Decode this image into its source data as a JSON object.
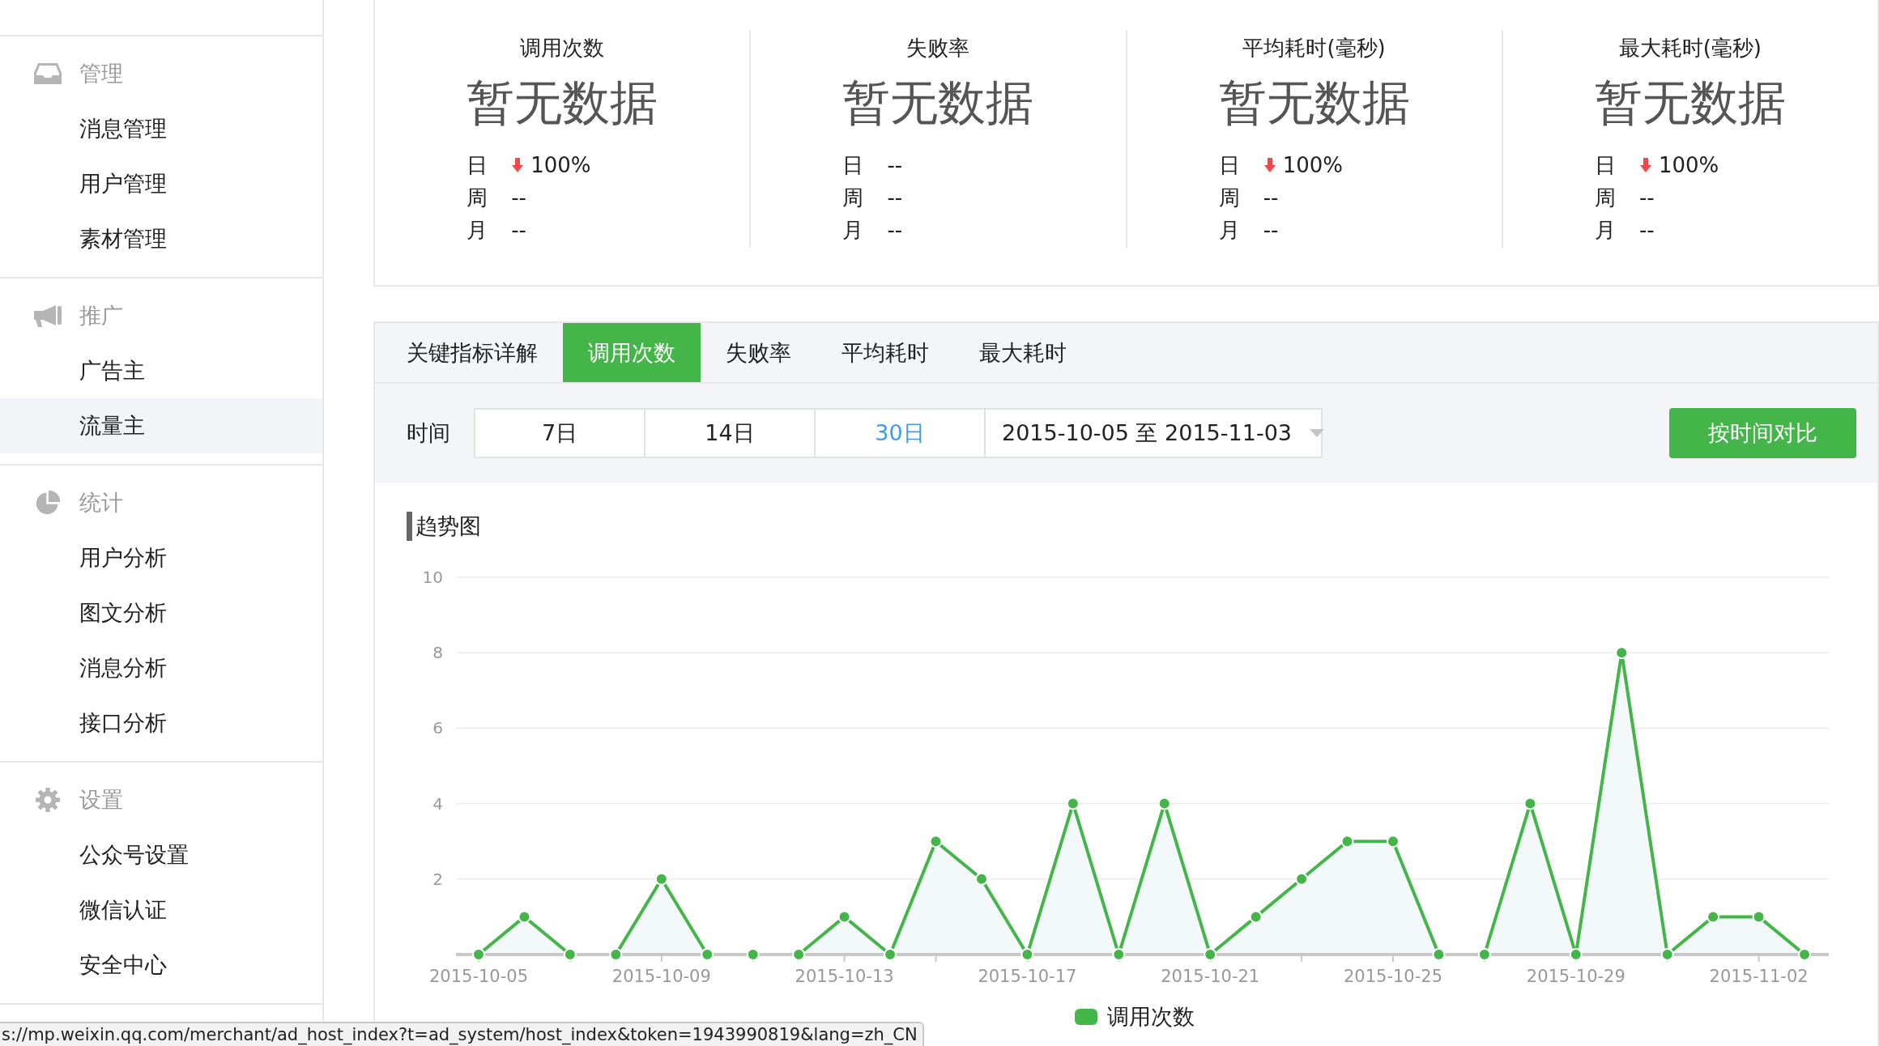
{
  "sidebar": {
    "sections": [
      {
        "title": "管理",
        "items": [
          {
            "label": "消息管理",
            "selected": false
          },
          {
            "label": "用户管理",
            "selected": false
          },
          {
            "label": "素材管理",
            "selected": false
          }
        ]
      },
      {
        "title": "推广",
        "items": [
          {
            "label": "广告主",
            "selected": false
          },
          {
            "label": "流量主",
            "selected": true
          }
        ]
      },
      {
        "title": "统计",
        "items": [
          {
            "label": "用户分析",
            "selected": false
          },
          {
            "label": "图文分析",
            "selected": false
          },
          {
            "label": "消息分析",
            "selected": false
          },
          {
            "label": "接口分析",
            "selected": false
          }
        ]
      },
      {
        "title": "设置",
        "items": [
          {
            "label": "公众号设置",
            "selected": false
          },
          {
            "label": "微信认证",
            "selected": false
          },
          {
            "label": "安全中心",
            "selected": false
          }
        ]
      }
    ]
  },
  "stats": [
    {
      "title": "调用次数",
      "value": "暂无数据",
      "rows": [
        {
          "label": "日",
          "down": true,
          "value": "100%"
        },
        {
          "label": "周",
          "down": false,
          "value": "--"
        },
        {
          "label": "月",
          "down": false,
          "value": "--"
        }
      ]
    },
    {
      "title": "失败率",
      "value": "暂无数据",
      "rows": [
        {
          "label": "日",
          "down": false,
          "value": "--"
        },
        {
          "label": "周",
          "down": false,
          "value": "--"
        },
        {
          "label": "月",
          "down": false,
          "value": "--"
        }
      ]
    },
    {
      "title": "平均耗时(毫秒)",
      "value": "暂无数据",
      "rows": [
        {
          "label": "日",
          "down": true,
          "value": "100%"
        },
        {
          "label": "周",
          "down": false,
          "value": "--"
        },
        {
          "label": "月",
          "down": false,
          "value": "--"
        }
      ]
    },
    {
      "title": "最大耗时(毫秒)",
      "value": "暂无数据",
      "rows": [
        {
          "label": "日",
          "down": true,
          "value": "100%"
        },
        {
          "label": "周",
          "down": false,
          "value": "--"
        },
        {
          "label": "月",
          "down": false,
          "value": "--"
        }
      ]
    }
  ],
  "tabs": [
    {
      "label": "关键指标详解",
      "selected": false
    },
    {
      "label": "调用次数",
      "selected": true
    },
    {
      "label": "失败率",
      "selected": false
    },
    {
      "label": "平均耗时",
      "selected": false
    },
    {
      "label": "最大耗时",
      "selected": false
    }
  ],
  "time_filter": {
    "label": "时间",
    "ranges": [
      {
        "label": "7日",
        "selected": false
      },
      {
        "label": "14日",
        "selected": false
      },
      {
        "label": "30日",
        "selected": true
      }
    ],
    "date_range": "2015-10-05 至 2015-11-03",
    "compare_button": "按时间对比"
  },
  "trend": {
    "title": "趋势图",
    "chart_data": {
      "type": "area",
      "categories": [
        "2015-10-05",
        null,
        null,
        null,
        "2015-10-09",
        null,
        null,
        null,
        "2015-10-13",
        null,
        null,
        null,
        "2015-10-17",
        null,
        null,
        null,
        "2015-10-21",
        null,
        null,
        null,
        "2015-10-25",
        null,
        null,
        null,
        "2015-10-29",
        null,
        null,
        null,
        "2015-11-02",
        null
      ],
      "series": [
        {
          "name": "调用次数",
          "color": "#44b549",
          "values": [
            0,
            1,
            0,
            0,
            2,
            0,
            0,
            0,
            1,
            0,
            3,
            2,
            0,
            4,
            0,
            4,
            0,
            1,
            2,
            3,
            3,
            0,
            0,
            4,
            0,
            8,
            0,
            1,
            1,
            0
          ]
        }
      ],
      "ylim": [
        0,
        10
      ],
      "yticks": [
        2,
        4,
        6,
        8,
        10
      ],
      "grid": true
    }
  },
  "status_bar": {
    "url": "s://mp.weixin.qq.com/merchant/ad_host_index?t=ad_system/host_index&token=1943990819&lang=zh_CN"
  }
}
